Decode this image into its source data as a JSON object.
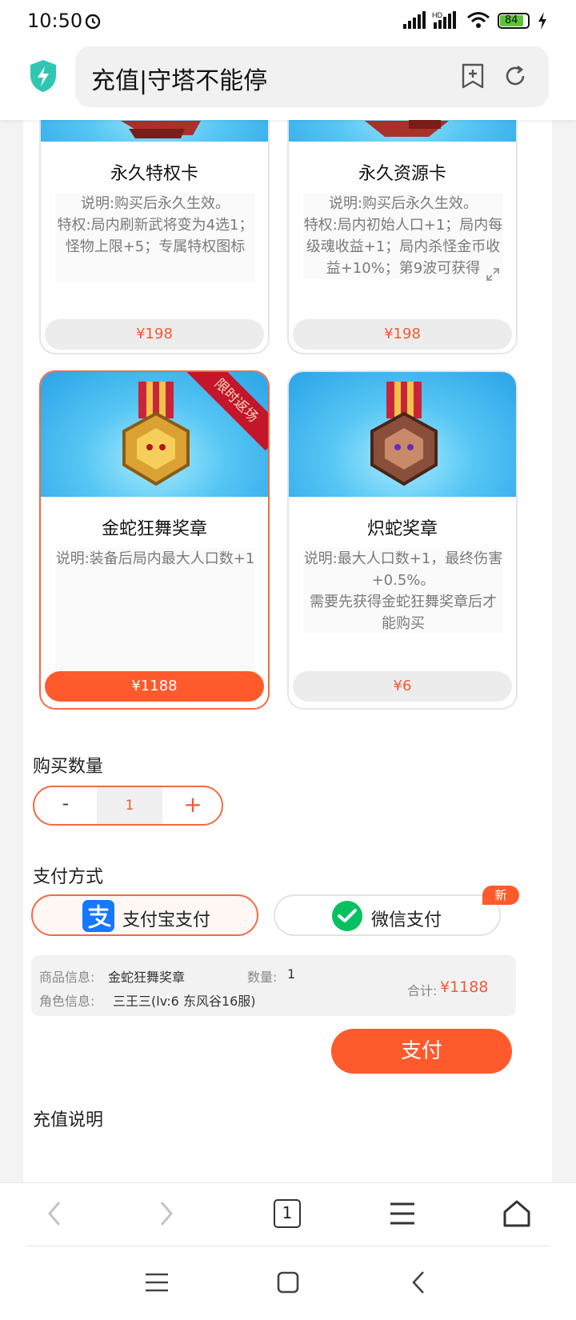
{
  "status_bar": {
    "time": "10:50",
    "battery": "84"
  },
  "browser": {
    "url_title": "充值|守塔不能停"
  },
  "products": [
    {
      "title": "永久特权卡",
      "desc": "说明:购买后永久生效。\n特权:局内刷新武将变为4选1；怪物上限+5；专属特权图标",
      "price": "¥198"
    },
    {
      "title": "永久资源卡",
      "desc": "说明:购买后永久生效。\n特权:局内初始人口+1；局内每级魂收益+1；局内杀怪金币收益+10%；第9波可获得",
      "price": "¥198"
    },
    {
      "title": "金蛇狂舞奖章",
      "desc": "说明:装备后局内最大人口数+1",
      "price": "¥1188",
      "ribbon": "限时返场"
    },
    {
      "title": "炽蛇奖章",
      "desc": "说明:最大人口数+1，最终伤害+0.5%。\n需要先获得金蛇狂舞奖章后才能购买",
      "price": "¥6"
    }
  ],
  "quantity": {
    "label": "购买数量",
    "minus": "-",
    "value": "1",
    "plus": "+"
  },
  "payment": {
    "label": "支付方式",
    "alipay": "支付宝支付",
    "wechat": "微信支付",
    "new_badge": "新"
  },
  "summary": {
    "product_label": "商品信息:",
    "product_value": "金蛇狂舞奖章",
    "qty_label": "数量:",
    "qty_value": "1",
    "role_label": "角色信息:",
    "role_value": "三王三(lv:6 东风谷16服)",
    "total_label": "合计:",
    "total_value": "¥1188"
  },
  "pay_button": "支付",
  "recharge_title": "充值说明",
  "toolbar": {
    "tab_count": "1"
  },
  "colors": {
    "accent": "#ff5a2c",
    "alipay": "#1677ff",
    "wechat": "#07c160"
  }
}
